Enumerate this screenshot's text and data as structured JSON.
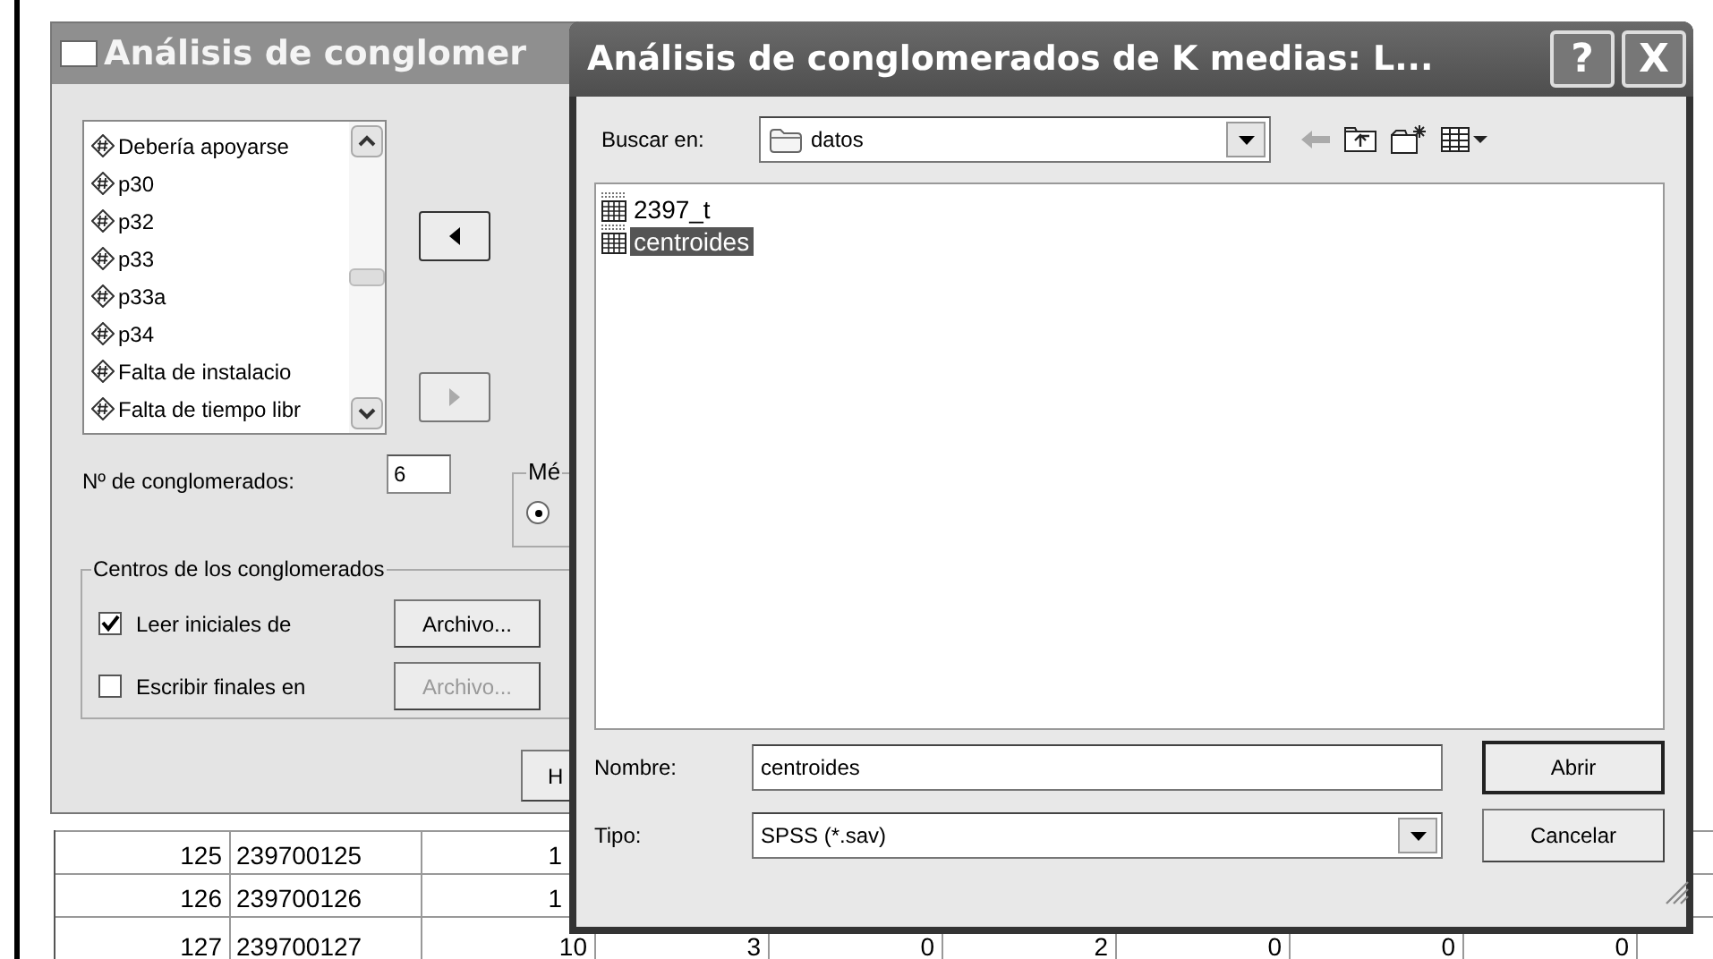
{
  "data_grid": {
    "rows": [
      {
        "cells": [
          "125",
          "239700125",
          "1"
        ]
      },
      {
        "cells": [
          "126",
          "239700126",
          "1"
        ]
      },
      {
        "cells": [
          "127",
          "239700127",
          "10",
          "3",
          "0",
          "2",
          "0",
          "0",
          "0"
        ]
      }
    ]
  },
  "back_dialog": {
    "title": "Análisis de conglomer",
    "variables": [
      {
        "label": "Debería apoyarse"
      },
      {
        "label": "p30"
      },
      {
        "label": "p32"
      },
      {
        "label": "p33"
      },
      {
        "label": "p33a"
      },
      {
        "label": "p34"
      },
      {
        "label": "Falta de instalacio"
      },
      {
        "label": "Falta de tiempo libr"
      }
    ],
    "move_buttons": [
      {
        "kind": "left",
        "disabled": false
      },
      {
        "kind": "right",
        "disabled": true
      }
    ],
    "clusters_label": "Nº de conglomerados:",
    "clusters_value": "6",
    "method_group": {
      "title": "Mé",
      "radio_selected": true
    },
    "centers_group": {
      "title": "Centros de los conglomerados",
      "options": [
        {
          "label": "Leer iniciales de",
          "checked": true,
          "button": "Archivo...",
          "button_disabled": false
        },
        {
          "label": "Escribir finales en",
          "checked": false,
          "button": "Archivo...",
          "button_disabled": true
        }
      ]
    },
    "partial_button": "H"
  },
  "open_dialog": {
    "title": "Análisis de conglomerados de K medias: L...",
    "title_buttons": [
      "?",
      "X"
    ],
    "look_in_label": "Buscar en:",
    "look_in_value": "datos",
    "files": [
      {
        "name": "2397_t",
        "selected": false
      },
      {
        "name": "centroides",
        "selected": true
      }
    ],
    "name_label": "Nombre:",
    "name_value": "centroides",
    "type_label": "Tipo:",
    "type_value": "SPSS (*.sav)",
    "buttons": [
      "Abrir",
      "Cancelar"
    ]
  }
}
